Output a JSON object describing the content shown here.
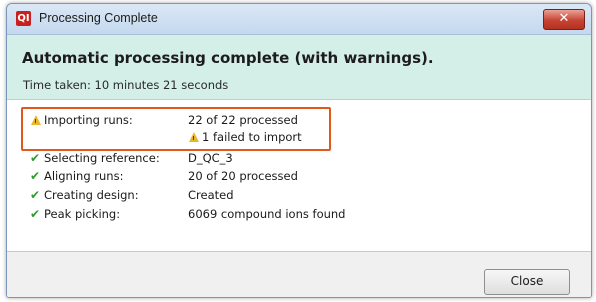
{
  "window": {
    "title": "Processing Complete",
    "app_icon": "QI",
    "close_glyph": "✕"
  },
  "header": {
    "heading": "Automatic processing complete (with warnings).",
    "time_taken": "Time taken: 10 minutes 21 seconds"
  },
  "results": [
    {
      "icon": "warning-icon",
      "label": "Importing runs:",
      "value": "22 of 22 processed"
    },
    {
      "icon": "checkmark-icon",
      "label": "Selecting reference:",
      "value": "D_QC_3"
    },
    {
      "icon": "checkmark-icon",
      "label": "Aligning runs:",
      "value": "20 of 20 processed"
    },
    {
      "icon": "checkmark-icon",
      "label": "Creating design:",
      "value": "Created"
    },
    {
      "icon": "checkmark-icon",
      "label": "Peak picking:",
      "value": "6069 compound ions found"
    }
  ],
  "import_warning": {
    "icon": "warning-icon",
    "text": "1 failed to import"
  },
  "colors": {
    "header_bg": "#d4eee8",
    "highlight_border": "#e2571b",
    "check_green": "#2f9a2f",
    "warning_yellow": "#e8b82b"
  },
  "footer": {
    "close_label": "Close"
  }
}
